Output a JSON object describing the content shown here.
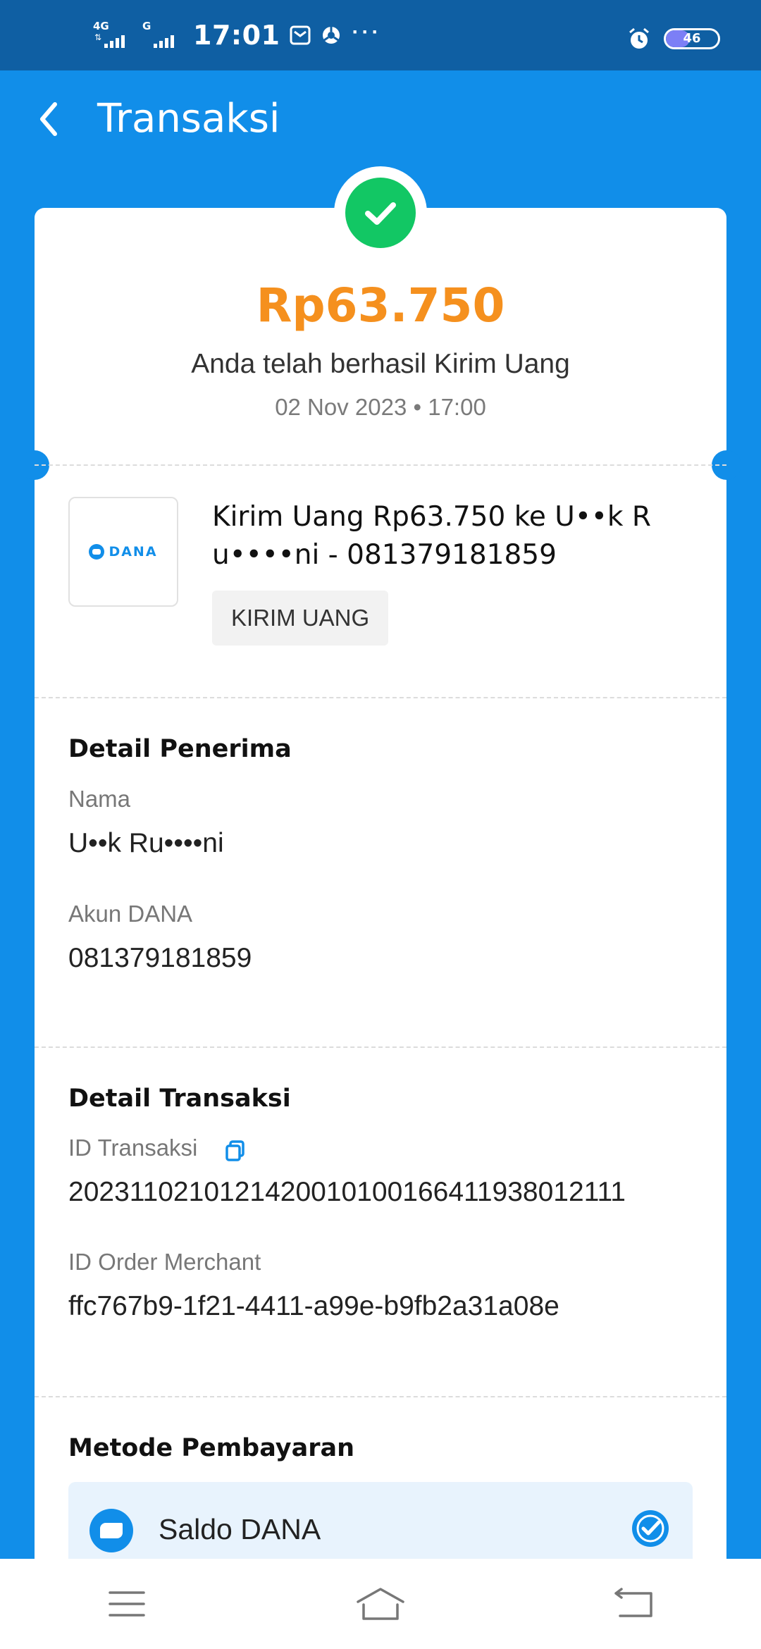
{
  "status_bar": {
    "net1": "4G",
    "net2": "G",
    "time": "17:01",
    "more": "···",
    "battery_level": "46"
  },
  "app_bar": {
    "title": "Transaksi"
  },
  "summary": {
    "amount": "Rp63.750",
    "message": "Anda telah berhasil Kirim Uang",
    "datetime": "02 Nov 2023 • 17:00"
  },
  "merchant": {
    "logo_text": "DANA",
    "description": "Kirim Uang Rp63.750 ke U••k R u••••ni - 081379181859",
    "tag": "KIRIM UANG"
  },
  "recipient": {
    "title": "Detail Penerima",
    "name_label": "Nama",
    "name_value": "U••k Ru••••ni",
    "account_label": "Akun DANA",
    "account_value": "081379181859"
  },
  "transaction": {
    "title": "Detail Transaksi",
    "id_label": "ID Transaksi",
    "id_value": "2023110210121420010100166411938012111",
    "order_label": "ID Order Merchant",
    "order_value": "ffc767b9-1f21-4411-a99e-b9fb2a31a08e"
  },
  "payment": {
    "title": "Metode Pembayaran",
    "method": "Saldo DANA"
  },
  "colors": {
    "primary": "#118ee9",
    "status_bar": "#0f5fa3",
    "amount": "#f5901e",
    "success": "#12c764"
  }
}
